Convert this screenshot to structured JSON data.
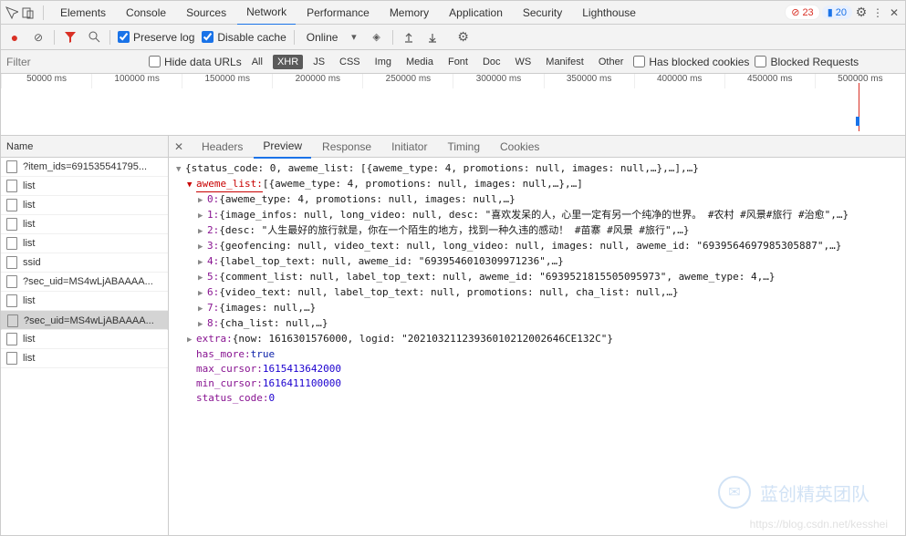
{
  "top_tabs": {
    "items": [
      "Elements",
      "Console",
      "Sources",
      "Network",
      "Performance",
      "Memory",
      "Application",
      "Security",
      "Lighthouse"
    ],
    "active": "Network",
    "errors": "23",
    "warnings": "20"
  },
  "toolbar": {
    "preserve_log": "Preserve log",
    "disable_cache": "Disable cache",
    "throttle": "Online"
  },
  "filter_row": {
    "filter_placeholder": "Filter",
    "hide_data_urls": "Hide data URLs",
    "types": [
      "All",
      "XHR",
      "JS",
      "CSS",
      "Img",
      "Media",
      "Font",
      "Doc",
      "WS",
      "Manifest",
      "Other"
    ],
    "active_type": "XHR",
    "has_blocked_cookies": "Has blocked cookies",
    "blocked_requests": "Blocked Requests"
  },
  "timeline": {
    "ticks": [
      "50000 ms",
      "100000 ms",
      "150000 ms",
      "200000 ms",
      "250000 ms",
      "300000 ms",
      "350000 ms",
      "400000 ms",
      "450000 ms",
      "500000 ms"
    ]
  },
  "left": {
    "header": "Name",
    "rows": [
      "?item_ids=691535541795...",
      "list",
      "list",
      "list",
      "list",
      "ssid",
      "?sec_uid=MS4wLjABAAAA...",
      "list",
      "?sec_uid=MS4wLjABAAAA...",
      "list",
      "list"
    ],
    "selected": 8
  },
  "detail_tabs": {
    "items": [
      "Headers",
      "Preview",
      "Response",
      "Initiator",
      "Timing",
      "Cookies"
    ],
    "active": "Preview"
  },
  "preview": {
    "root": "{status_code: 0, aweme_list: [{aweme_type: 4, promotions: null, images: null,…},…],…}",
    "aweme_list_key": "aweme_list:",
    "aweme_list_val": " [{aweme_type: 4, promotions: null, images: null,…},…]",
    "items": [
      {
        "idx": "0:",
        "val": " {aweme_type: 4, promotions: null, images: null,…}"
      },
      {
        "idx": "1:",
        "val": " {image_infos: null, long_video: null, desc: \"喜欢发呆的人，心里一定有另一个纯净的世界。 #农村 #风景#旅行 #治愈\",…}"
      },
      {
        "idx": "2:",
        "val": " {desc: \"人生最好的旅行就是，你在一个陌生的地方，找到一种久违的感动！ #苗寨 #风景 #旅行\",…}"
      },
      {
        "idx": "3:",
        "val": " {geofencing: null, video_text: null, long_video: null, images: null, aweme_id: \"6939564697985305887\",…}"
      },
      {
        "idx": "4:",
        "val": " {label_top_text: null, aweme_id: \"6939546010309971236\",…}"
      },
      {
        "idx": "5:",
        "val": " {comment_list: null, label_top_text: null, aweme_id: \"6939521815505095973\", aweme_type: 4,…}"
      },
      {
        "idx": "6:",
        "val": " {video_text: null, label_top_text: null, promotions: null, cha_list: null,…}"
      },
      {
        "idx": "7:",
        "val": " {images: null,…}"
      },
      {
        "idx": "8:",
        "val": " {cha_list: null,…}"
      }
    ],
    "extra_key": "extra:",
    "extra_val": " {now: 1616301576000, logid: \"202103211239360102120026​46CE132C\"}",
    "has_more_key": "has_more: ",
    "has_more_val": "true",
    "max_cursor_key": "max_cursor: ",
    "max_cursor_val": "1615413642000",
    "min_cursor_key": "min_cursor: ",
    "min_cursor_val": "1616411100000",
    "status_code_key": "status_code: ",
    "status_code_val": "0"
  },
  "watermark": {
    "text": "蓝创精英团队",
    "url": "https://blog.csdn.net/kesshei"
  }
}
